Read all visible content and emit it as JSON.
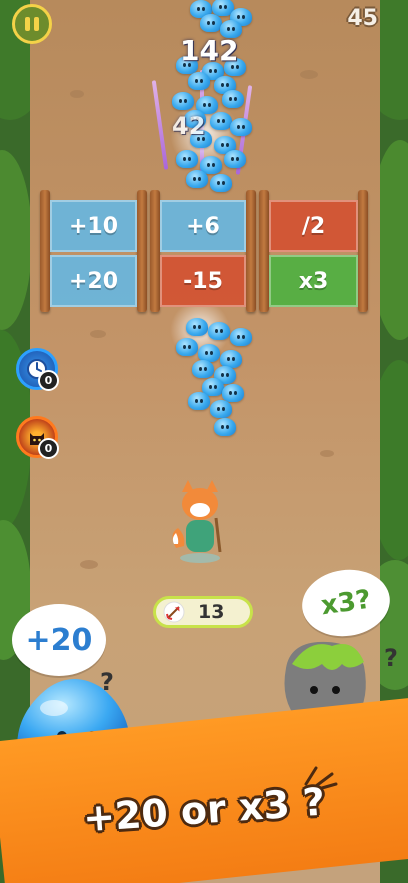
{
  "hud": {
    "pause_icon": "pause-icon",
    "level": "45"
  },
  "crowd": {
    "top_count": "142",
    "faded_count": "42"
  },
  "gates": {
    "row1": [
      {
        "label": "+10",
        "color": "blue"
      },
      {
        "label": "+6",
        "color": "blue"
      },
      {
        "label": "/2",
        "color": "red"
      }
    ],
    "row2": [
      {
        "label": "+20",
        "color": "blue"
      },
      {
        "label": "-15",
        "color": "red"
      },
      {
        "label": "x3",
        "color": "green"
      }
    ]
  },
  "powerups": [
    {
      "icon": "clock-icon",
      "count": "0"
    },
    {
      "icon": "cat-icon",
      "count": "0"
    }
  ],
  "ammo": {
    "icon": "arrow-icon",
    "value": "13"
  },
  "mascots": {
    "slime_bubble": "+20",
    "slime_mark": "?",
    "rock_bubble": "x3?",
    "rock_mark": "?"
  },
  "caption": "+20 or x3 ?",
  "colors": {
    "banner": "#f48a1a",
    "gate_blue": "#68b6de",
    "gate_red": "#d35232",
    "gate_green": "#52b042",
    "hud_ring": "#f4d248"
  }
}
